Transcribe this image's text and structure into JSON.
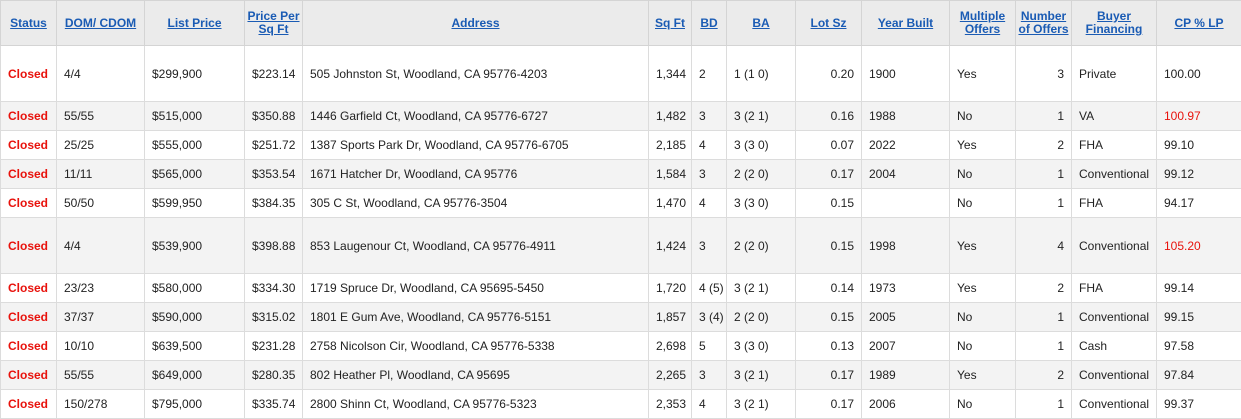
{
  "columns": [
    "Status",
    "DOM/ CDOM",
    "List Price",
    "Price Per Sq Ft",
    "Address",
    "Sq Ft",
    "BD",
    "BA",
    "Lot Sz",
    "Year Built",
    "Multiple Offers",
    "Number of Offers",
    "Buyer Financing",
    "CP % LP"
  ],
  "colors": {
    "closed": "#e8120c",
    "link": "#1a5bb4",
    "header_bg": "#ebebeb",
    "alt_row_bg": "#f3f3f3"
  },
  "rows": [
    {
      "status": "Closed",
      "dom": "4/4",
      "list_price": "$299,900",
      "ppsf": "$223.14",
      "address": "505 Johnston St, Woodland, CA 95776-4203",
      "sqft": "1,344",
      "bd": "2",
      "ba": "1 (1 0)",
      "lot": "0.20",
      "year": "1900",
      "multiple": "Yes",
      "offers": "3",
      "financing": "Private",
      "cp_lp": "100.00"
    },
    {
      "status": "Closed",
      "dom": "55/55",
      "list_price": "$515,000",
      "ppsf": "$350.88",
      "address": "1446 Garfield Ct, Woodland, CA 95776-6727",
      "sqft": "1,482",
      "bd": "3",
      "ba": "3 (2 1)",
      "lot": "0.16",
      "year": "1988",
      "multiple": "No",
      "offers": "1",
      "financing": "VA",
      "cp_lp": "100.97"
    },
    {
      "status": "Closed",
      "dom": "25/25",
      "list_price": "$555,000",
      "ppsf": "$251.72",
      "address": "1387 Sports Park Dr, Woodland, CA 95776-6705",
      "sqft": "2,185",
      "bd": "4",
      "ba": "3 (3 0)",
      "lot": "0.07",
      "year": "2022",
      "multiple": "Yes",
      "offers": "2",
      "financing": "FHA",
      "cp_lp": "99.10"
    },
    {
      "status": "Closed",
      "dom": "11/11",
      "list_price": "$565,000",
      "ppsf": "$353.54",
      "address": "1671 Hatcher Dr, Woodland, CA 95776",
      "sqft": "1,584",
      "bd": "3",
      "ba": "2 (2 0)",
      "lot": "0.17",
      "year": "2004",
      "multiple": "No",
      "offers": "1",
      "financing": "Conventional",
      "cp_lp": "99.12"
    },
    {
      "status": "Closed",
      "dom": "50/50",
      "list_price": "$599,950",
      "ppsf": "$384.35",
      "address": "305 C St, Woodland, CA 95776-3504",
      "sqft": "1,470",
      "bd": "4",
      "ba": "3 (3 0)",
      "lot": "0.15",
      "year": "",
      "multiple": "No",
      "offers": "1",
      "financing": "FHA",
      "cp_lp": "94.17"
    },
    {
      "status": "Closed",
      "dom": "4/4",
      "list_price": "$539,900",
      "ppsf": "$398.88",
      "address": "853 Laugenour Ct, Woodland, CA 95776-4911",
      "sqft": "1,424",
      "bd": "3",
      "ba": "2 (2 0)",
      "lot": "0.15",
      "year": "1998",
      "multiple": "Yes",
      "offers": "4",
      "financing": "Conventional",
      "cp_lp": "105.20"
    },
    {
      "status": "Closed",
      "dom": "23/23",
      "list_price": "$580,000",
      "ppsf": "$334.30",
      "address": "1719 Spruce Dr, Woodland, CA 95695-5450",
      "sqft": "1,720",
      "bd": "4 (5)",
      "ba": "3 (2 1)",
      "lot": "0.14",
      "year": "1973",
      "multiple": "Yes",
      "offers": "2",
      "financing": "FHA",
      "cp_lp": "99.14"
    },
    {
      "status": "Closed",
      "dom": "37/37",
      "list_price": "$590,000",
      "ppsf": "$315.02",
      "address": "1801 E Gum Ave, Woodland, CA 95776-5151",
      "sqft": "1,857",
      "bd": "3 (4)",
      "ba": "2 (2 0)",
      "lot": "0.15",
      "year": "2005",
      "multiple": "No",
      "offers": "1",
      "financing": "Conventional",
      "cp_lp": "99.15"
    },
    {
      "status": "Closed",
      "dom": "10/10",
      "list_price": "$639,500",
      "ppsf": "$231.28",
      "address": "2758 Nicolson Cir, Woodland, CA 95776-5338",
      "sqft": "2,698",
      "bd": "5",
      "ba": "3 (3 0)",
      "lot": "0.13",
      "year": "2007",
      "multiple": "No",
      "offers": "1",
      "financing": "Cash",
      "cp_lp": "97.58"
    },
    {
      "status": "Closed",
      "dom": "55/55",
      "list_price": "$649,000",
      "ppsf": "$280.35",
      "address": "802 Heather Pl, Woodland, CA 95695",
      "sqft": "2,265",
      "bd": "3",
      "ba": "3 (2 1)",
      "lot": "0.17",
      "year": "1989",
      "multiple": "Yes",
      "offers": "2",
      "financing": "Conventional",
      "cp_lp": "97.84"
    },
    {
      "status": "Closed",
      "dom": "150/278",
      "list_price": "$795,000",
      "ppsf": "$335.74",
      "address": "2800 Shinn Ct, Woodland, CA 95776-5323",
      "sqft": "2,353",
      "bd": "4",
      "ba": "3 (2 1)",
      "lot": "0.17",
      "year": "2006",
      "multiple": "No",
      "offers": "1",
      "financing": "Conventional",
      "cp_lp": "99.37"
    }
  ]
}
